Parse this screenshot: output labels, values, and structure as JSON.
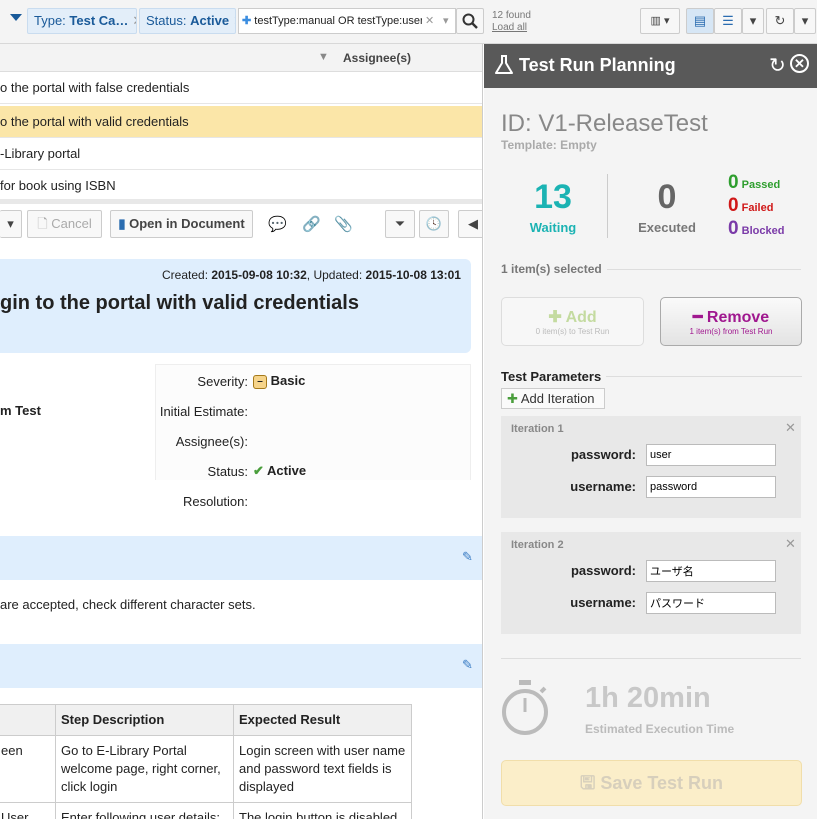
{
  "filters": {
    "chip1": "Type: ",
    "chip1_val": "Test Ca…",
    "chip2": "Status: ",
    "chip2_val": "Active",
    "query_value": "testType:manual OR testType:user",
    "found": "12 found",
    "load_all": "Load all"
  },
  "grid": {
    "col_assignee": "Assignee(s)",
    "rows": [
      "o the portal with false credentials",
      "o the portal with valid credentials",
      "-Library portal",
      "for book using ISBN"
    ]
  },
  "toolbar": {
    "cancel": "Cancel",
    "open_doc": "Open in Document"
  },
  "detail": {
    "created_label": "Created:",
    "created": "2015-09-08 10:32",
    "updated_label": "Updated:",
    "updated": "2015-10-08 13:01",
    "title": "gin to the portal with valid credentials",
    "left_value": "m Test",
    "severity_label": "Severity:",
    "severity": "Basic",
    "estimate_label": "Initial Estimate:",
    "assignee_label": "Assignee(s):",
    "status_label": "Status:",
    "status": "Active",
    "resolution_label": "Resolution:",
    "description": "are accepted, check different character sets."
  },
  "steps": {
    "headers": [
      "",
      "Step Description",
      "Expected Result"
    ],
    "rows": [
      [
        "een",
        "Go to E-Library Portal welcome page, right corner, click login",
        "Login screen with user name and password text fields is displayed"
      ],
      [
        "User",
        "Enter following user details:",
        "The login button is disabled"
      ]
    ]
  },
  "panel": {
    "title": "Test Run Planning",
    "id": "ID: V1-ReleaseTest",
    "template": "Template: Empty",
    "waiting_count": "13",
    "waiting": "Waiting",
    "executed_count": "0",
    "executed": "Executed",
    "passed_count": "0",
    "passed": "Passed",
    "failed_count": "0",
    "failed": "Failed",
    "blocked_count": "0",
    "blocked": "Blocked",
    "selected": "1 item(s) selected",
    "add": "Add",
    "add_sub": "0 item(s) to Test Run",
    "remove": "Remove",
    "remove_sub": "1 item(s) from Test Run",
    "params": "Test Parameters",
    "add_iteration": "Add Iteration",
    "iterations": [
      {
        "title": "Iteration 1",
        "password_label": "password:",
        "password": "user",
        "username_label": "username:",
        "username": "password"
      },
      {
        "title": "Iteration 2",
        "password_label": "password:",
        "password": "ユーザ名",
        "username_label": "username:",
        "username": "パスワード"
      }
    ],
    "time": "1h 20min",
    "time_label": "Estimated Execution Time",
    "save": "Save Test Run"
  },
  "colors": {
    "waiting": "#1bb3b3",
    "passed": "#2e9e2e",
    "failed": "#d01818",
    "blocked": "#7a3aa8",
    "remove": "#a0188f",
    "highlight": "#fbe6a8"
  }
}
